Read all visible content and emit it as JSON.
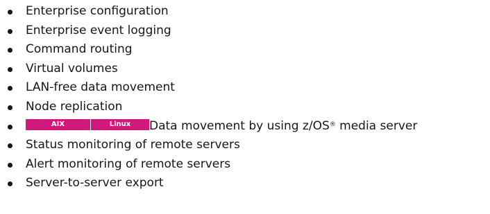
{
  "badge_color": "#d0197b",
  "features": [
    "Enterprise configuration",
    "Enterprise event logging",
    "Command routing",
    "Virtual volumes",
    "LAN-free data movement",
    "Node replication"
  ],
  "platform_feature": {
    "badges": [
      "AIX",
      "Linux"
    ],
    "text_before": "Data movement by using z/OS",
    "registered_mark": "®",
    "text_after": " media server"
  },
  "features_after": [
    "Status monitoring of remote servers",
    "Alert monitoring of remote servers",
    "Server-to-server export"
  ]
}
